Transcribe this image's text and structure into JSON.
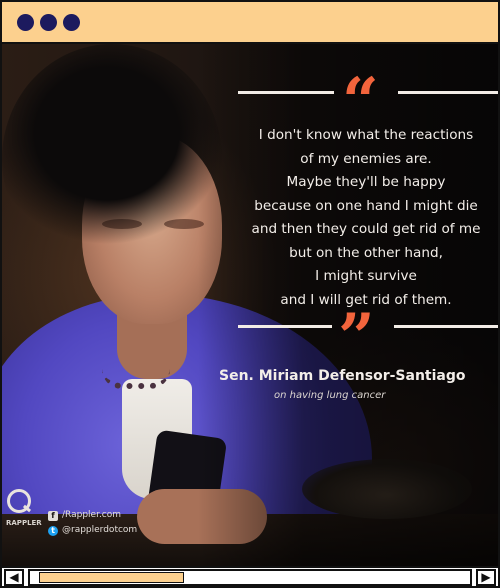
{
  "window": {
    "titlebar_color": "#fcd08e",
    "dot_color": "#1c1a5e",
    "traffic_lights": [
      "window-dot",
      "window-dot",
      "window-dot"
    ]
  },
  "image": {
    "quote_mark_color": "#f2643c",
    "quote_open": "“",
    "quote_close": "”",
    "quote_lines": [
      "I don't know what the reactions",
      "of my enemies are.",
      "Maybe they'll be happy",
      "because on one hand I might die",
      "and then they could get rid of me",
      "but on the other hand,",
      "I might survive",
      "and I will get rid of them."
    ],
    "attribution": "Sen. Miriam Defensor-Santiago",
    "attribution_sub": "on having lung cancer",
    "brand_text": "RAPPLER",
    "social": [
      {
        "icon": "facebook-icon",
        "glyph": "f",
        "text": "/Rappler.com"
      },
      {
        "icon": "twitter-icon",
        "glyph": "t",
        "text": "@rapplerdotcom"
      }
    ]
  },
  "scrollbar": {
    "left_arrow": "◀",
    "right_arrow": "▶",
    "thumb_position": 0.02,
    "thumb_fraction": 0.33
  }
}
